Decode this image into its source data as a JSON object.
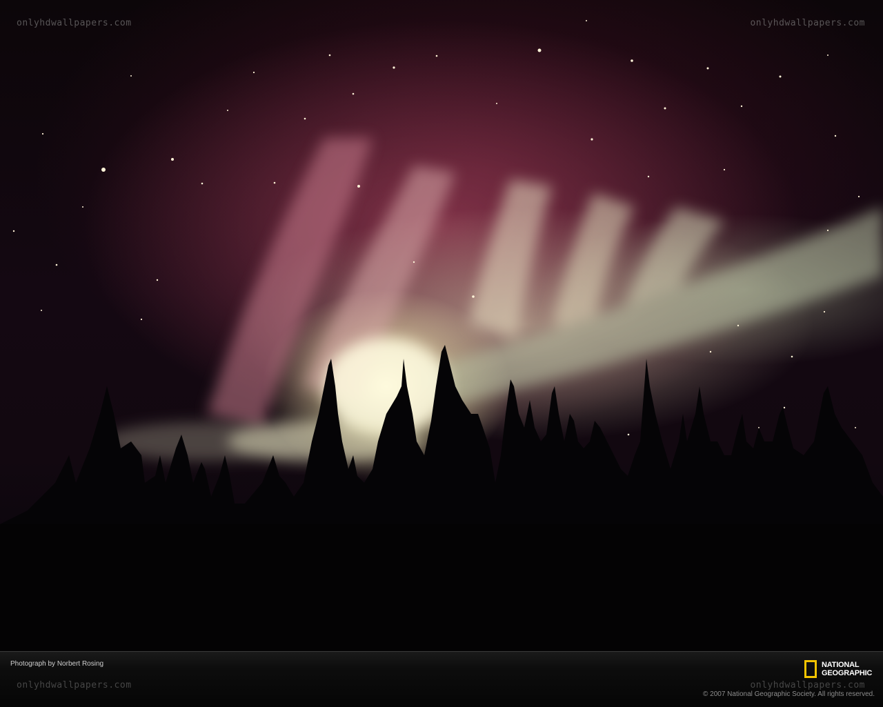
{
  "watermark": {
    "top_left": "onlyhdwallpapers.com",
    "top_right": "onlyhdwallpapers.com",
    "bottom_left": "onlyhdwallpapers.com",
    "bottom_right": "onlyhdwallpapers.com"
  },
  "footer": {
    "credit": "Photograph by Norbert Rosing",
    "copyright": "© 2007 National Geographic Society. All rights reserved.",
    "logo": {
      "line1": "NATIONAL",
      "line2": "GEOGRAPHIC",
      "icon": "yellow-border-rectangle-icon",
      "accent": "#f4c400"
    }
  },
  "scene": {
    "subject": "aurora-borealis",
    "colors": {
      "sky": "#0c0609",
      "aurora_pink": "#aa465f",
      "aurora_glow": "#fffcd2",
      "aurora_green": "#aab996",
      "trees": "#050406"
    }
  }
}
